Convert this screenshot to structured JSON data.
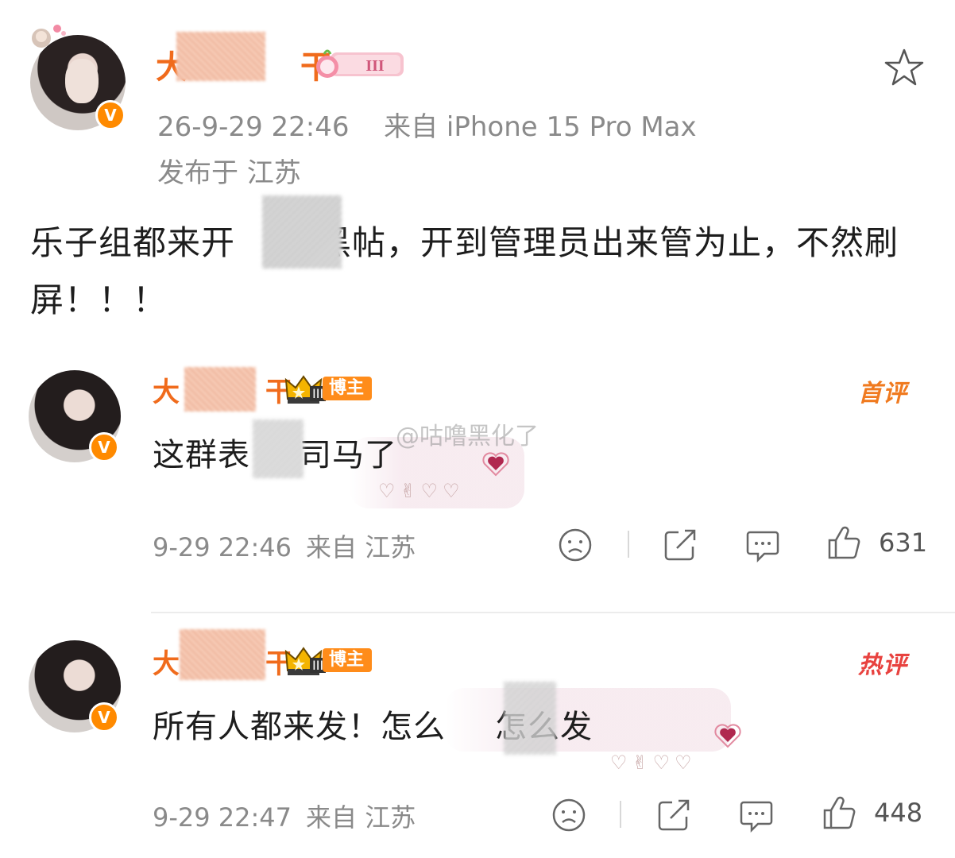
{
  "post": {
    "author_name_start": "大",
    "author_name_end": "干",
    "level_badge": "III",
    "verified_icon": "v-badge-icon",
    "timestamp": "26-9-29 22:46",
    "source": "来自 iPhone 15 Pro Max",
    "location": "发布于 江苏",
    "text_part1": "乐子组都来开",
    "text_part2": "黑帖，开到管理员出来管为止，不然刷屏！！！",
    "favorite_icon": "star-icon"
  },
  "comments": [
    {
      "name_start": "大",
      "name_end": "干",
      "level": "III",
      "badge": "博主",
      "tag": "首评",
      "tag_color": "#f07a1f",
      "text_part1": "这群表",
      "text_part2": "司马了",
      "time": "9-29 22:46",
      "from": "来自 江苏",
      "likes": "631"
    },
    {
      "name_start": "大",
      "name_end": "干",
      "level": "III",
      "badge": "博主",
      "tag": "热评",
      "tag_color": "#e8423f",
      "text_part1": "所有人都来发！怎么",
      "text_part2": "怎么发",
      "time": "9-29 22:47",
      "from": "来自 江苏",
      "likes": "448"
    }
  ],
  "watermark": "@咕噜黑化了",
  "colors": {
    "name": "#f06b1c",
    "meta": "#8a8a8a",
    "badge": "#ff8c1a"
  }
}
